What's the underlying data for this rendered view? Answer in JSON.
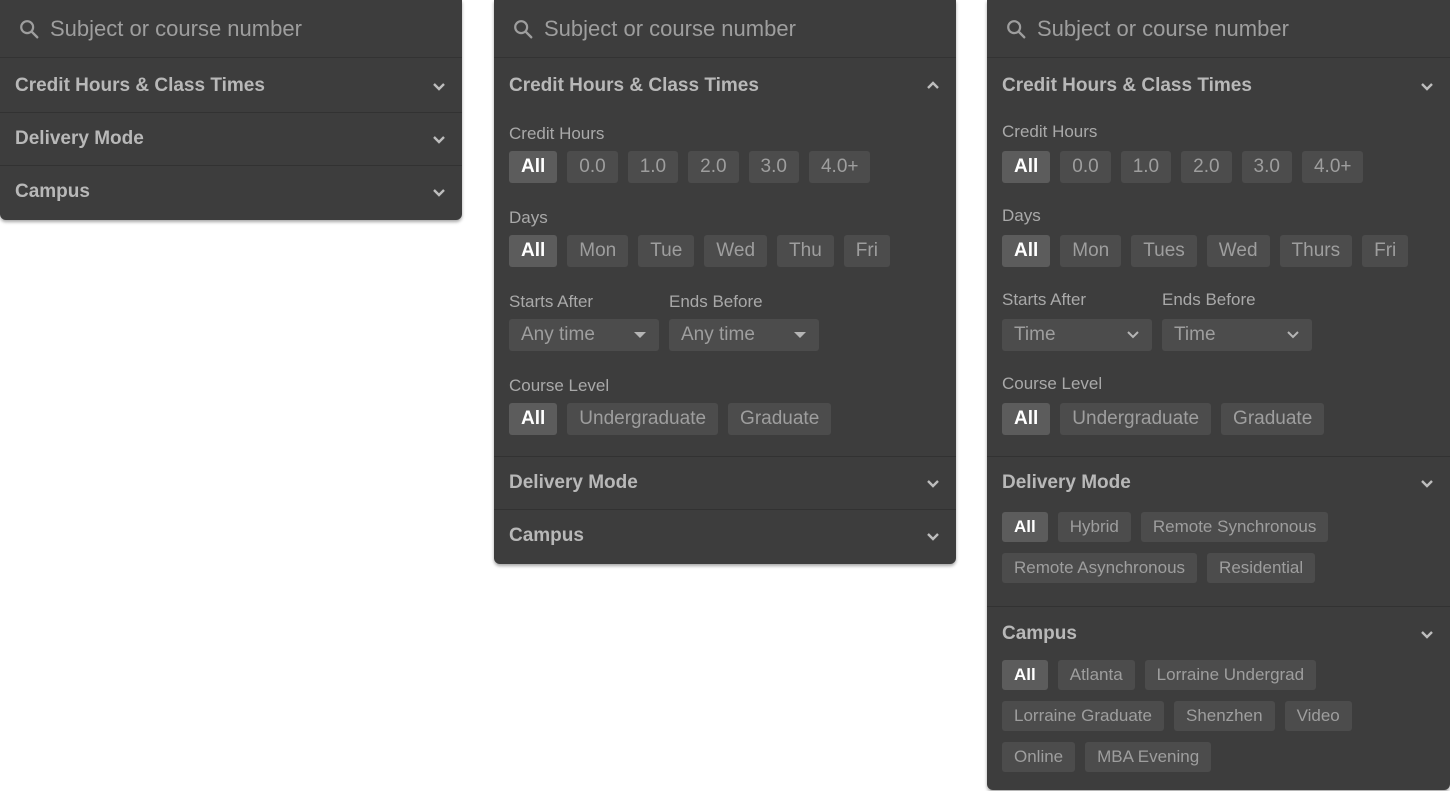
{
  "search": {
    "placeholder": "Subject or course number"
  },
  "sections": {
    "credit": "Credit Hours & Class Times",
    "delivery": "Delivery Mode",
    "campus": "Campus"
  },
  "labels": {
    "credit_hours": "Credit Hours",
    "days": "Days",
    "starts_after": "Starts After",
    "ends_before": "Ends Before",
    "course_level": "Course Level"
  },
  "panel2": {
    "credit_chips": [
      "All",
      "0.0",
      "1.0",
      "2.0",
      "3.0",
      "4.0+"
    ],
    "day_chips": [
      "All",
      "Mon",
      "Tue",
      "Wed",
      "Thu",
      "Fri"
    ],
    "starts_value": "Any time",
    "ends_value": "Any time",
    "level_chips": [
      "All",
      "Undergraduate",
      "Graduate"
    ]
  },
  "panel3": {
    "credit_chips": [
      "All",
      "0.0",
      "1.0",
      "2.0",
      "3.0",
      "4.0+"
    ],
    "day_chips": [
      "All",
      "Mon",
      "Tues",
      "Wed",
      "Thurs",
      "Fri"
    ],
    "starts_value": "Time",
    "ends_value": "Time",
    "level_chips": [
      "All",
      "Undergraduate",
      "Graduate"
    ],
    "delivery_chips": [
      "All",
      "Hybrid",
      "Remote Synchronous",
      "Remote Asynchronous",
      "Residential"
    ],
    "campus_chips": [
      "All",
      "Atlanta",
      "Lorraine Undergrad",
      "Lorraine Graduate",
      "Shenzhen",
      "Video",
      "Online",
      "MBA Evening"
    ]
  },
  "icons": {
    "search": "search-icon",
    "chevron_down": "chevron-down-icon",
    "chevron_up": "chevron-up-icon",
    "caret": "caret-down-icon"
  },
  "colors": {
    "panel_bg": "#3d3d3d",
    "chip_bg": "#4c4c4c",
    "chip_active_bg": "#5c5c5c"
  }
}
